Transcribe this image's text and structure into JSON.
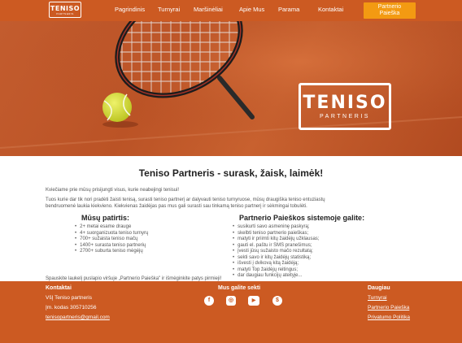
{
  "nav": {
    "logo_main": "TENISO",
    "logo_sub": "PARTNERIS",
    "items": [
      "Pagrindinis",
      "Turnyrai",
      "Maršinėliai",
      "Apie Mus",
      "Parama",
      "Kontaktai"
    ],
    "cta_line1": "Partnerio",
    "cta_line2": "Paieška"
  },
  "hero": {
    "logo_main": "TENISO",
    "logo_sub": "PARTNERIS"
  },
  "main": {
    "title": "Teniso Partneris - surask, žaisk, laimėk!",
    "intro": "Kviečiame prie mūsų prisijungti visus, kurie neabejingi tenisui!",
    "paragraph_line1": "Tuos kurie dar tik nori pradėti žaisti tenisą, surasti teniso partnerį ar dalyvauti teniso turnyruose, mūsų draugiška teniso entuziastų",
    "paragraph_line2": "bendruomenė laukia kiekvieno. Kiekvienas žaidėjas pas mus gali surasti sau tinkamą teniso partnerį ir sėkmingai tobulėti.",
    "left_title": "Mūsų patirtis:",
    "left_items": [
      "2+ metai esame drauge",
      "4+ suorganizuota teniso turnyrų",
      "700+ sužaista teniso mačų",
      "1400+ surasta teniso partnerių",
      "2700+ suburta teniso mėgėjų"
    ],
    "right_title": "Partnerio Paieškos sistemoje galite:",
    "right_items": [
      "susikurti savo asmeninę paskyrą;",
      "skelbti teniso partnerio paieškas;",
      "matyti ir priimti kitų žaidėjų užklausas;",
      "gauti el. paštu ir SMS pranešimus;",
      "įvesti jūsų sužaisto mačo rezultatą;",
      "sekti savo ir kitų žaidėjų statistiką;",
      "išvesti į dvikovą kitą žaidėją;",
      "matyti Top žaidėjų reitingus;",
      "dar daugiau funkcijų ateityje..."
    ],
    "footer_note": "Spauskite laukelį puslapio viršuje „Partnerio Paieška\" ir išmėginkite patys pirmieji!"
  },
  "footer": {
    "contacts_title": "Kontaktai",
    "org": "VšĮ Teniso partneris",
    "code": "Įm. kodas 305710256",
    "email": "tenisopartneris@gmail.com",
    "social_title": "Mus galite sekti",
    "social_icons": [
      "facebook-icon",
      "instagram-icon",
      "youtube-icon",
      "other-social-icon"
    ],
    "more_title": "Daugiau",
    "more_links": [
      "Turnyrai",
      "Partnerio Paieška",
      "Privatumo Politika"
    ]
  },
  "colors": {
    "brand_orange": "#cc5a22",
    "cta_orange": "#f39a12",
    "ball": "#d8e23a"
  }
}
